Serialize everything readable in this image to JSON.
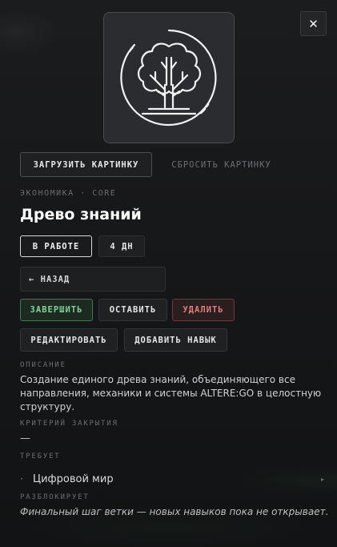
{
  "close": {
    "icon": "close-icon",
    "glyph": "✕"
  },
  "image": {
    "icon": "tree-icon"
  },
  "actions": {
    "upload_label": "ЗАГРУЗИТЬ КАРТИНКУ",
    "reset_label": "СБРОСИТЬ КАРТИНКУ"
  },
  "node": {
    "meta": "ЭКОНОМИКА · CORE",
    "title": "Древо знаний",
    "status": "В РАБОТЕ",
    "duration": "4 ДН"
  },
  "nav": {
    "back_label": "← НАЗАД"
  },
  "buttons": {
    "finish": "ЗАВЕРШИТЬ",
    "leave": "ОСТАВИТЬ",
    "delete": "УДАЛИТЬ",
    "edit": "РЕДАКТИРОВАТЬ",
    "add_skill": "ДОБАВИТЬ НАВЫК"
  },
  "sections": {
    "description_label": "ОПИСАНИЕ",
    "description_text": "Создание единого древа знаний, объединяющего все направления, механики и системы ALTERE:GO в целостную структуру.",
    "criteria_label": "КРИТЕРИЙ ЗАКРЫТИЯ",
    "criteria_value": "—",
    "requires_label": "ТРЕБУЕТ",
    "requires_items": [
      {
        "bullet": "·",
        "name": "Цифровой мир",
        "arrow": "▸"
      }
    ],
    "unlocks_label": "РАЗБЛОКИРУЕТ",
    "unlocks_note": "Финальный шаг ветки — новых навыков пока не открывает."
  },
  "colors": {
    "accent_green": "#7fd49a",
    "danger_red": "#e07b7e",
    "background": "#151617"
  }
}
